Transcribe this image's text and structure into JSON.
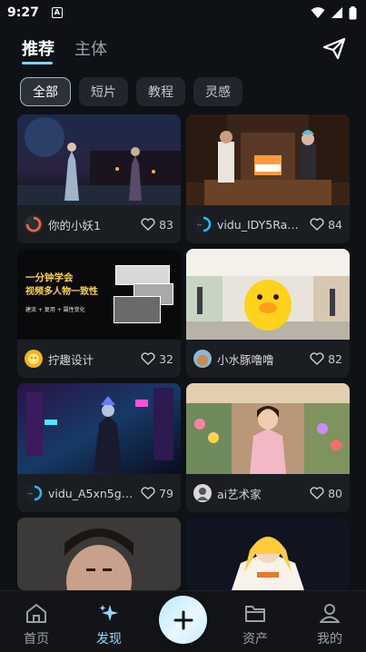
{
  "status_bar": {
    "time": "9:27",
    "indicator": "A"
  },
  "header": {
    "tabs": [
      {
        "label": "推荐",
        "active": true
      },
      {
        "label": "主体",
        "active": false
      }
    ],
    "action_icon": "send-icon"
  },
  "filters": [
    {
      "label": "全部",
      "active": true
    },
    {
      "label": "短片",
      "active": false
    },
    {
      "label": "教程",
      "active": false
    },
    {
      "label": "灵感",
      "active": false
    }
  ],
  "cards": [
    {
      "user": "你的小妖1",
      "likes": "83"
    },
    {
      "user": "vidu_IDY5RaFt...",
      "likes": "84"
    },
    {
      "user": "拧趣设计",
      "likes": "32",
      "thumb_text": {
        "title": "一分钟学会",
        "headline": "视频多人物一致性",
        "tags": "建流 + 复用 + 属性变化"
      }
    },
    {
      "user": "小水豚噜噜",
      "likes": "82"
    },
    {
      "user": "vidu_A5xn5gy...",
      "likes": "79"
    },
    {
      "user": "ai艺术家",
      "likes": "80"
    },
    {
      "user": "",
      "likes": ""
    },
    {
      "user": "",
      "likes": ""
    }
  ],
  "bottom_nav": [
    {
      "label": "首页",
      "icon": "home-icon",
      "active": false
    },
    {
      "label": "发现",
      "icon": "sparkle-icon",
      "active": true
    },
    {
      "label": "",
      "icon": "plus-icon",
      "active": false
    },
    {
      "label": "资产",
      "icon": "folder-icon",
      "active": false
    },
    {
      "label": "我的",
      "icon": "person-icon",
      "active": false
    }
  ],
  "colors": {
    "accent": "#8fd7ff",
    "background": "#0e1116",
    "card": "#1a1d22"
  }
}
